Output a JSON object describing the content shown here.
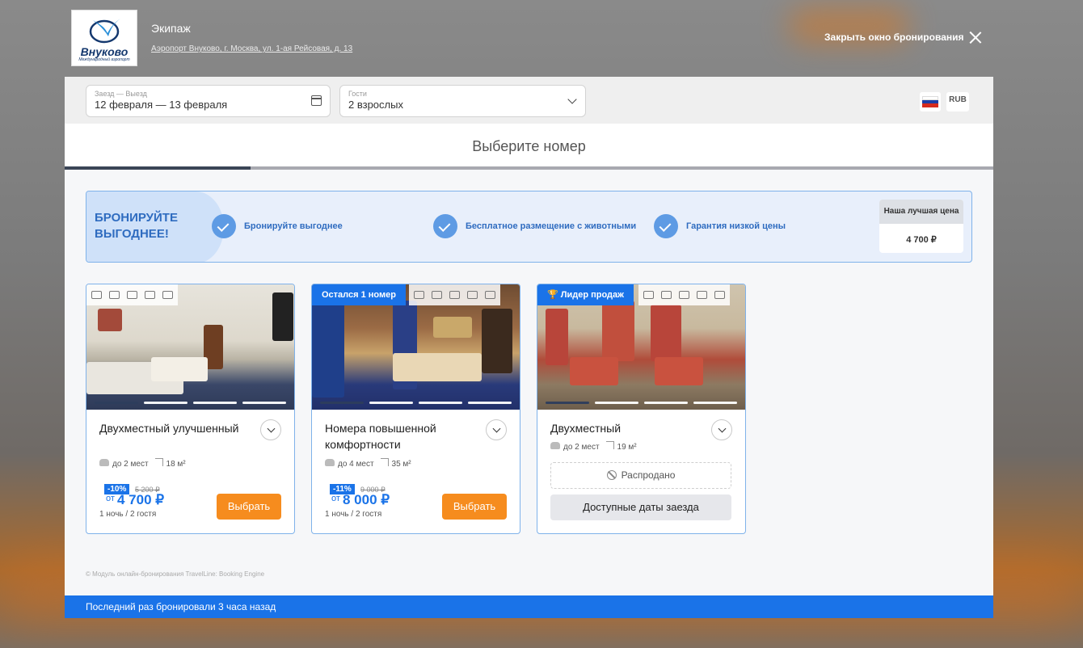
{
  "colors": {
    "accent": "#1a73e8",
    "orange_button": "#f68c1e",
    "banner_bg": "#e8effb"
  },
  "header": {
    "logo_text": "Внуково",
    "logo_sub": "Международный аэропорт",
    "hotel_name": "Экипаж",
    "address": "Аэропорт Внуково, г. Москва, ул. 1-ая Рейсовая, д. 13",
    "close_label": "Закрыть окно бронирования"
  },
  "search": {
    "dates_label": "Заезд — Выезд",
    "dates_value": "12 февраля — 13 февраля",
    "guests_label": "Гости",
    "guests_value": "2 взрослых",
    "currency": "RUB",
    "language_flag": "ru-flag-icon"
  },
  "page_title": "Выберите номер",
  "progress_fraction": 0.2,
  "promo": {
    "title": "БРОНИРУЙТЕ ВЫГОДНЕЕ!",
    "perks": [
      "Бронируйте выгоднее",
      "Бесплатное размещение с животными",
      "Гарантия низкой цены"
    ],
    "best_price_label": "Наша лучшая цена",
    "best_price_value": "4 700 ₽"
  },
  "rooms": [
    {
      "name": "Двухместный улучшенный",
      "badge": "",
      "capacity": "до 2 мест",
      "area": "18 м²",
      "discount": "-10%",
      "old_price": "5 200 ₽",
      "from": "от",
      "price": "4 700 ₽",
      "conditions": "1 ночь / 2 гостя",
      "button": "Выбрать"
    },
    {
      "name": "Номера повышенной комфортности",
      "badge": "Остался 1 номер",
      "capacity": "до 4 мест",
      "area": "35 м²",
      "discount": "-11%",
      "old_price": "9 000 ₽",
      "from": "от",
      "price": "8 000 ₽",
      "conditions": "1 ночь / 2 гостя",
      "button": "Выбрать"
    },
    {
      "name": "Двухместный",
      "badge": "Лидер продаж",
      "capacity": "до 2 мест",
      "area": "19 м²",
      "sold_out": "Распродано",
      "button": "Доступные даты заезда"
    }
  ],
  "copyright": "© Модуль онлайн-бронирования TravelLine: Booking Engine",
  "bottom_bar": "Последний раз бронировали 3 часа назад"
}
